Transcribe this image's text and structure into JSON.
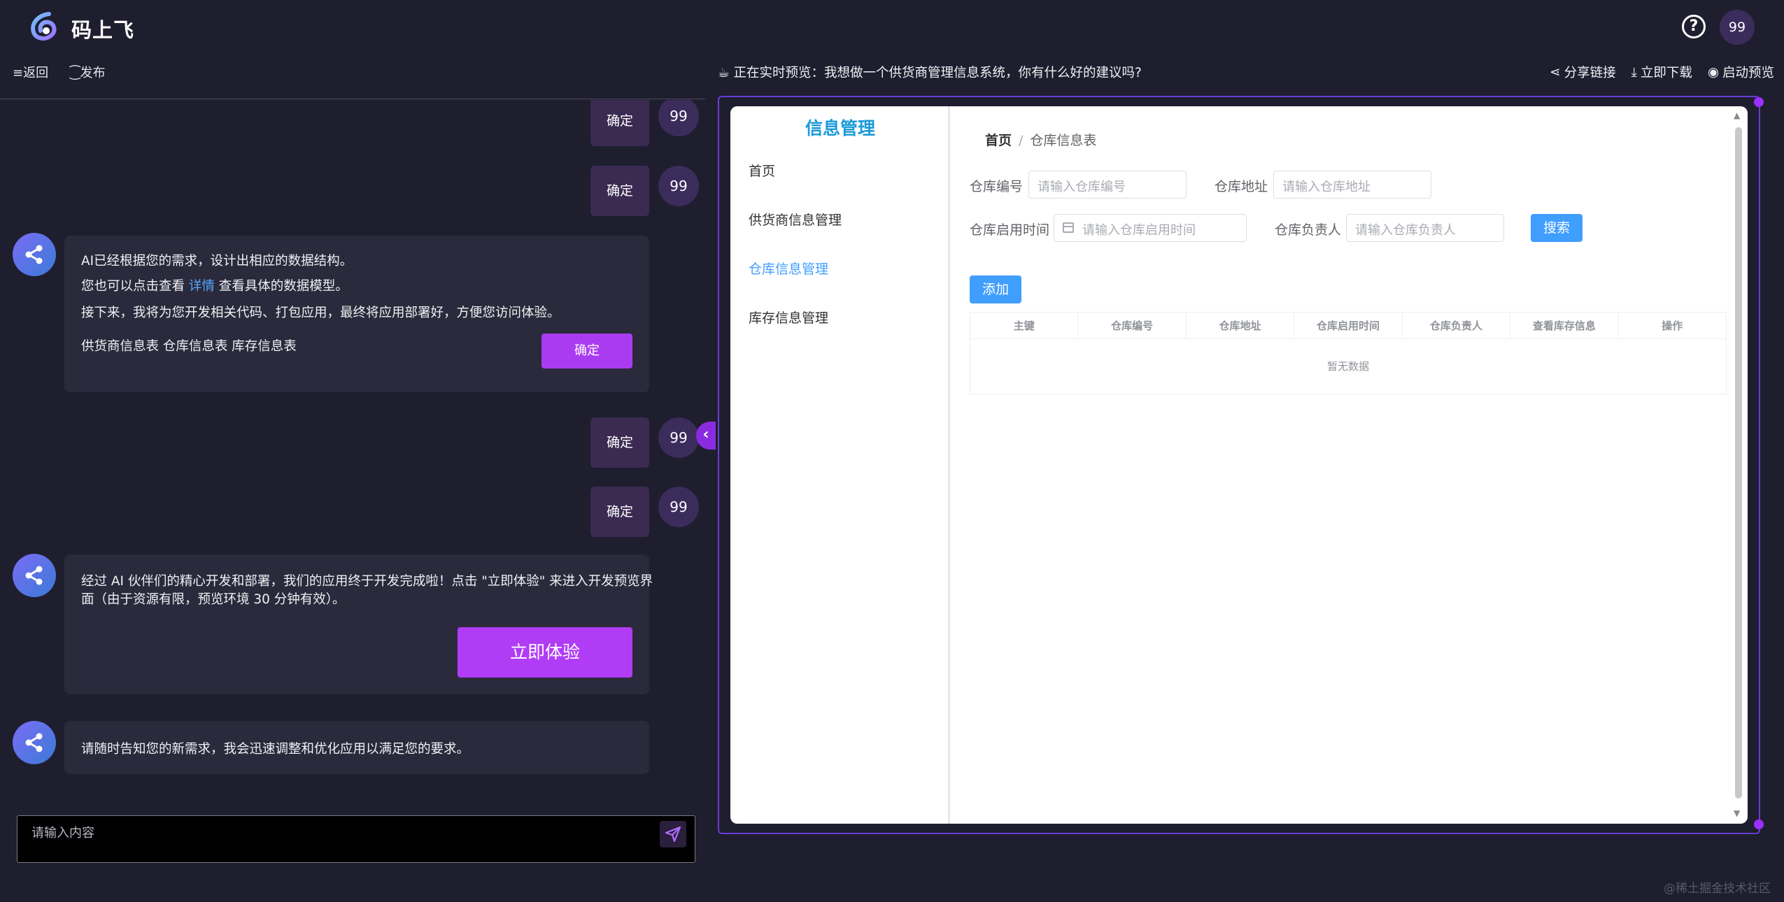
{
  "app": {
    "title": "码上飞",
    "user_avatar": "99"
  },
  "toolbar": {
    "back": "≡返回",
    "publish": "⁐发布"
  },
  "chat": {
    "ok_label": "确定",
    "avatar_label": "99",
    "ai_message_1": {
      "line1": "AI已经根据您的需求，设计出相应的数据结构。",
      "line2_prefix": "您也可以点击查看 ",
      "line2_link": "详情",
      "line2_suffix": " 查看具体的数据模型。",
      "line3": "接下来，我将为您开发相关代码、打包应用，最终将应用部署好，方便您访问体验。",
      "tables": "供货商信息表 仓库信息表 库存信息表",
      "button": "确定"
    },
    "ai_message_2": {
      "line1": "经过 AI 伙伴们的精心开发和部署，我们的应用终于开发完成啦！点击 \"立即体验\" 来进入开发预览界",
      "line2": "面（由于资源有限，预览环境 30 分钟有效）。",
      "button": "立即体验"
    },
    "ai_message_3": {
      "line1": "请随时告知您的新需求，我会迅速调整和优化应用以满足您的要求。"
    },
    "input_placeholder": "请输入内容"
  },
  "preview": {
    "title": "正在实时预览：我想做一个供货商管理信息系统，你有什么好的建议吗?",
    "share": "分享链接",
    "download": "立即下载",
    "launch": "启动预览"
  },
  "inner_app": {
    "brand": "信息管理",
    "menu": [
      "首页",
      "供货商信息管理",
      "仓库信息管理",
      "库存信息管理"
    ],
    "active_menu": "仓库信息管理",
    "breadcrumb": {
      "home": "首页",
      "sep": "/",
      "current": "仓库信息表"
    },
    "filters": {
      "code_label": "仓库编号",
      "code_placeholder": "请输入仓库编号",
      "address_label": "仓库地址",
      "address_placeholder": "请输入仓库地址",
      "date_label": "仓库启用时间",
      "date_placeholder": "请输入仓库启用时间",
      "owner_label": "仓库负责人",
      "owner_placeholder": "请输入仓库负责人",
      "search_button": "搜索"
    },
    "add_button": "添加",
    "table": {
      "columns": [
        "主键",
        "仓库编号",
        "仓库地址",
        "仓库启用时间",
        "仓库负责人",
        "查看库存信息",
        "操作"
      ],
      "empty_text": "暂无数据"
    }
  },
  "watermark": "@稀土掘金技术社区",
  "colors": {
    "accent": "#a93cf0",
    "primary": "#409eff",
    "brand": "#1c9ad8"
  }
}
